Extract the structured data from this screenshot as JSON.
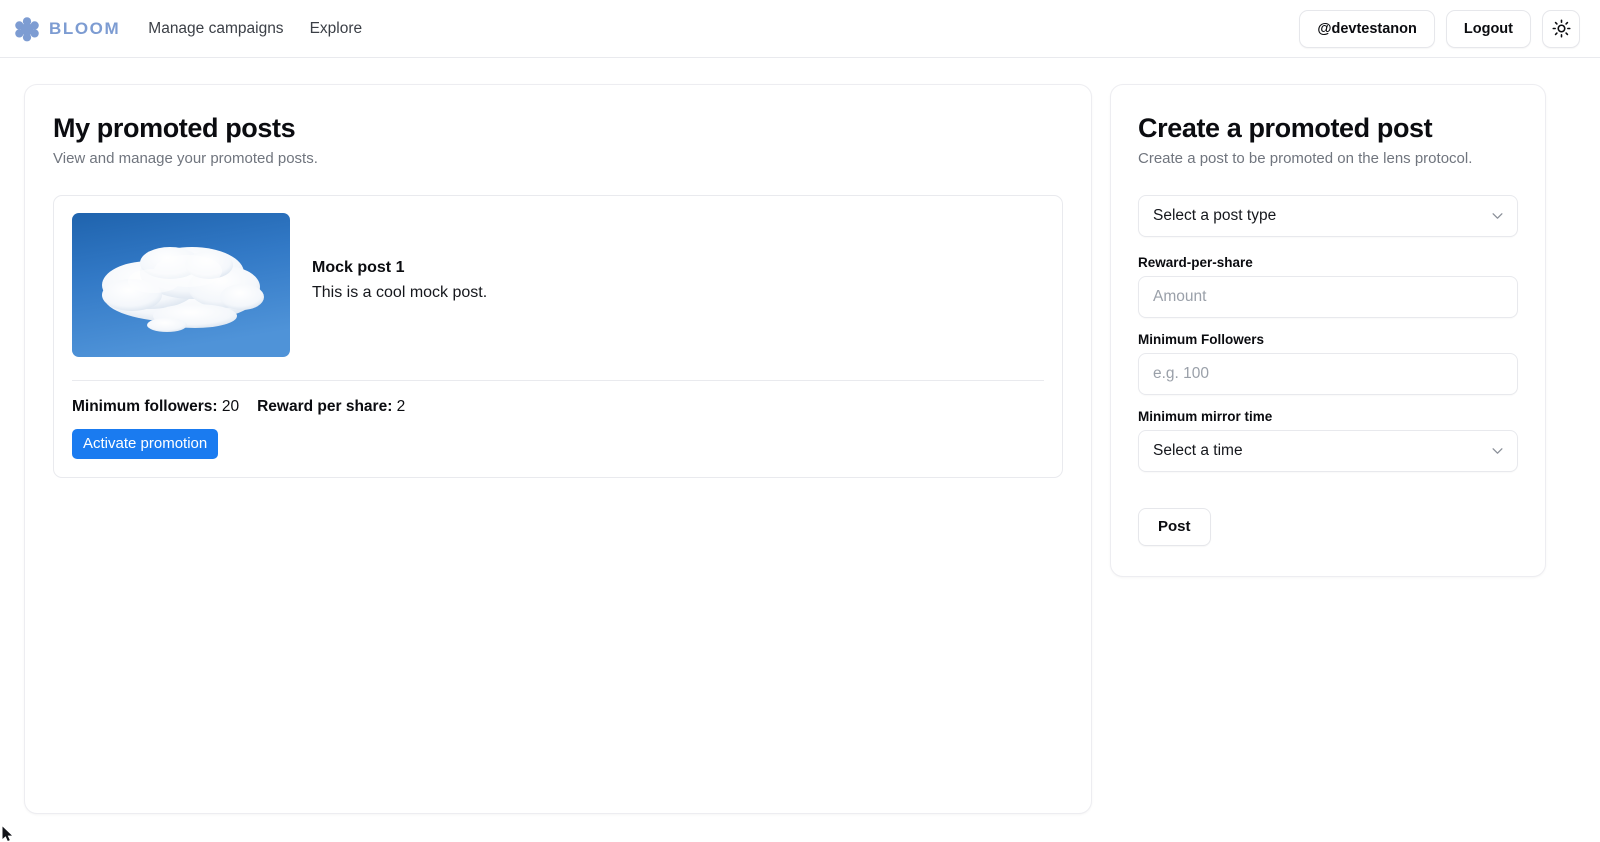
{
  "brand": {
    "name": "BLOOM",
    "logo_icon": "flower-puzzle-icon",
    "logo_color": "#7d9cd2"
  },
  "nav": {
    "links": [
      {
        "label": "Manage campaigns"
      },
      {
        "label": "Explore"
      }
    ]
  },
  "account": {
    "handle": "@devtestanon",
    "logout_label": "Logout",
    "theme_toggle_icon": "sun-icon"
  },
  "promoted_posts_panel": {
    "title": "My promoted posts",
    "subtitle": "View and manage your promoted posts.",
    "posts": [
      {
        "image_alt": "cloud-photo",
        "title": "Mock post 1",
        "body": "This is a cool mock post.",
        "min_followers_label": "Minimum followers:",
        "min_followers_value": "20",
        "reward_per_share_label": "Reward per share:",
        "reward_per_share_value": "2",
        "action_label": "Activate promotion"
      }
    ]
  },
  "create_panel": {
    "title": "Create a promoted post",
    "subtitle": "Create a post to be promoted on the lens protocol.",
    "post_type": {
      "label": "",
      "selected": "Select a post type",
      "chevron_icon": "chevron-down-icon"
    },
    "reward_per_share": {
      "label": "Reward-per-share",
      "value": "",
      "placeholder": "Amount"
    },
    "minimum_followers": {
      "label": "Minimum Followers",
      "value": "",
      "placeholder": "e.g. 100"
    },
    "minimum_mirror_time": {
      "label": "Minimum mirror time",
      "selected": "Select a time",
      "chevron_icon": "chevron-down-icon"
    },
    "submit_label": "Post"
  },
  "colors": {
    "primary_button": "#1a7bf0",
    "brand": "#7d9cd2",
    "border": "#e9eaee",
    "muted_text": "#70757e"
  }
}
